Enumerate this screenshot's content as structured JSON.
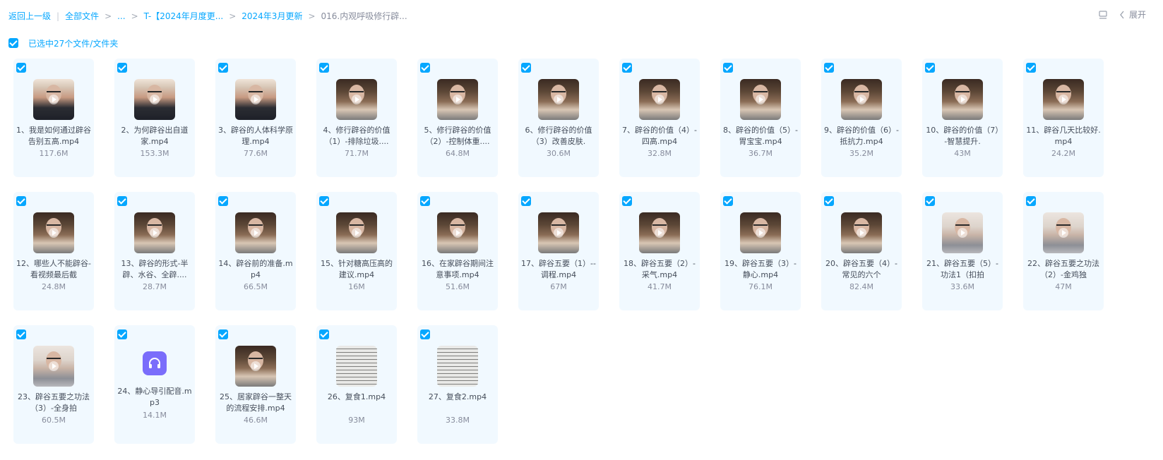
{
  "breadcrumb": {
    "back": "返回上一级",
    "all_files": "全部文件",
    "ellipsis": "...",
    "folder1": "T-【2024年月度更...",
    "folder2": "2024年3月更新",
    "current": "016.内观呼吸修行辟..."
  },
  "toolbar": {
    "expand_label": "展开"
  },
  "selection": {
    "label": "已选中27个文件/文件夹"
  },
  "files": [
    {
      "name": "1、我是如何通过辟谷告别五高.mp4",
      "size": "117.6M"
    },
    {
      "name": "2、为何辟谷出自道家.mp4",
      "size": "153.3M"
    },
    {
      "name": "3、辟谷的人体科学原理.mp4",
      "size": "77.6M"
    },
    {
      "name": "4、修行辟谷的价值（1）-排除垃圾....",
      "size": "71.7M"
    },
    {
      "name": "5、修行辟谷的价值（2）-控制体重....",
      "size": "64.8M"
    },
    {
      "name": "6、修行辟谷的价值（3）改善皮肤.",
      "size": "30.6M"
    },
    {
      "name": "7、辟谷的价值（4）-四高.mp4",
      "size": "32.8M"
    },
    {
      "name": "8、辟谷的价值（5）-胃宝宝.mp4",
      "size": "36.7M"
    },
    {
      "name": "9、辟谷的价值（6）-抵抗力.mp4",
      "size": "35.2M"
    },
    {
      "name": "10、辟谷的价值（7）-智慧提升.",
      "size": "43M"
    },
    {
      "name": "11、辟谷几天比较好.mp4",
      "size": "24.2M"
    },
    {
      "name": "12、哪些人不能辟谷-看视频最后截",
      "size": "24.8M"
    },
    {
      "name": "13、辟谷的形式-半辟、水谷、全辟....",
      "size": "28.7M"
    },
    {
      "name": "14、辟谷前的准备.mp4",
      "size": "66.5M"
    },
    {
      "name": "15、针对糖高压高的建议.mp4",
      "size": "16M"
    },
    {
      "name": "16、在家辟谷期间注意事项.mp4",
      "size": "51.6M"
    },
    {
      "name": "17、辟谷五要（1）--调程.mp4",
      "size": "67M"
    },
    {
      "name": "18、辟谷五要（2）-采气.mp4",
      "size": "41.7M"
    },
    {
      "name": "19、辟谷五要（3）-静心.mp4",
      "size": "76.1M"
    },
    {
      "name": "20、辟谷五要（4）-常见的六个",
      "size": "82.4M"
    },
    {
      "name": "21、辟谷五要（5）-功法1（扣拍",
      "size": "33.6M"
    },
    {
      "name": "22、辟谷五要之功法（2）-金鸡独",
      "size": "47M"
    },
    {
      "name": "23、辟谷五要之功法（3）-全身拍",
      "size": "60.5M"
    },
    {
      "name": "24、静心导引配音.mp3",
      "size": "14.1M"
    },
    {
      "name": "25、居家辟谷一整天的流程安排.mp4",
      "size": "46.6M"
    },
    {
      "name": "26、复食1.mp4",
      "size": "93M"
    },
    {
      "name": "27、复食2.mp4",
      "size": "33.8M"
    }
  ]
}
